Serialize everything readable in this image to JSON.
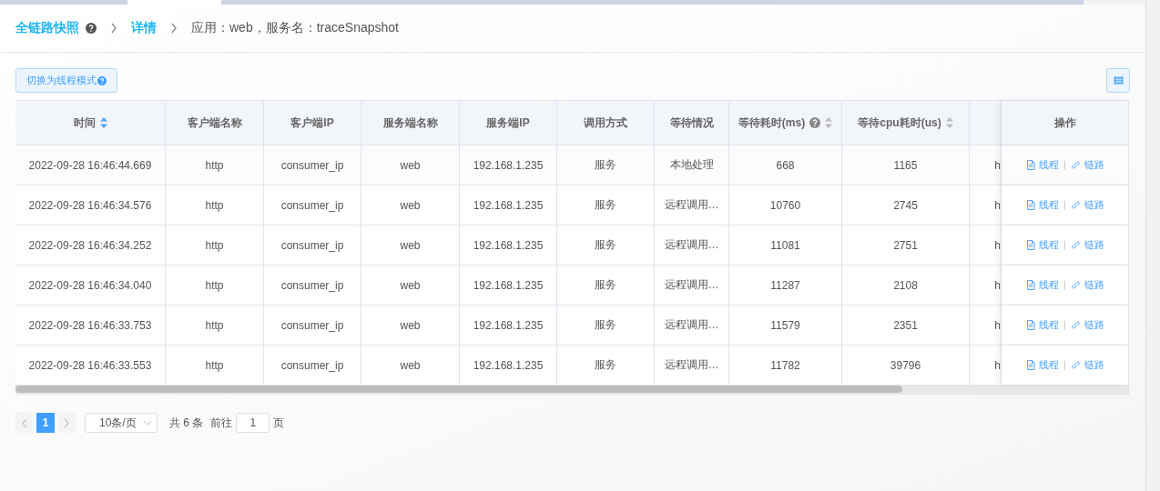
{
  "breadcrumb": [
    {
      "label": "全链路快照",
      "kind": "link",
      "help": true
    },
    {
      "label": "详情",
      "kind": "link",
      "help": false
    },
    {
      "label": "应用：web，服务名：traceSnapshot",
      "kind": "text",
      "help": false
    }
  ],
  "toolbar": {
    "mode_button": "切换为线程模式"
  },
  "table": {
    "columns": [
      {
        "label": "时间",
        "sortable": true,
        "sort_active": true,
        "help": false
      },
      {
        "label": "客户端名称",
        "sortable": false,
        "help": false
      },
      {
        "label": "客户端IP",
        "sortable": false,
        "help": false
      },
      {
        "label": "服务端名称",
        "sortable": false,
        "help": false
      },
      {
        "label": "服务端IP",
        "sortable": false,
        "help": false
      },
      {
        "label": "调用方式",
        "sortable": false,
        "help": false
      },
      {
        "label": "等待情况",
        "sortable": false,
        "help": false
      },
      {
        "label": "等待耗时(ms)",
        "sortable": true,
        "sort_active": false,
        "help": true
      },
      {
        "label": "等待cpu耗时(us)",
        "sortable": true,
        "sort_active": false,
        "help": false
      },
      {
        "sortable": false,
        "help": false
      },
      {
        "label": "操作",
        "sortable": false,
        "help": false
      }
    ],
    "rows": [
      {
        "cells": [
          "2022-09-28 16:46:44.669",
          "http",
          "consumer_ip",
          "web",
          "192.168.1.235",
          "服务",
          "本地处理",
          "668",
          "1165",
          "h"
        ],
        "actions": [
          "线程",
          "链路"
        ]
      },
      {
        "cells": [
          "2022-09-28 16:46:34.576",
          "http",
          "consumer_ip",
          "web",
          "192.168.1.235",
          "服务",
          "远程调用…",
          "10760",
          "2745",
          "h"
        ],
        "actions": [
          "线程",
          "链路"
        ]
      },
      {
        "cells": [
          "2022-09-28 16:46:34.252",
          "http",
          "consumer_ip",
          "web",
          "192.168.1.235",
          "服务",
          "远程调用…",
          "11081",
          "2751",
          "h"
        ],
        "actions": [
          "线程",
          "链路"
        ]
      },
      {
        "cells": [
          "2022-09-28 16:46:34.040",
          "http",
          "consumer_ip",
          "web",
          "192.168.1.235",
          "服务",
          "远程调用…",
          "11287",
          "2108",
          "h"
        ],
        "actions": [
          "线程",
          "链路"
        ]
      },
      {
        "cells": [
          "2022-09-28 16:46:33.753",
          "http",
          "consumer_ip",
          "web",
          "192.168.1.235",
          "服务",
          "远程调用…",
          "11579",
          "2351",
          "h"
        ],
        "actions": [
          "线程",
          "链路"
        ]
      },
      {
        "cells": [
          "2022-09-28 16:46:33.553",
          "http",
          "consumer_ip",
          "web",
          "192.168.1.235",
          "服务",
          "远程调用…",
          "11782",
          "39796",
          "h"
        ],
        "actions": [
          "线程",
          "链路"
        ]
      }
    ]
  },
  "pager": {
    "pages": [
      {
        "label": "1",
        "selected": true
      }
    ],
    "page_size": "10条/页",
    "total": "共 6 条",
    "goto_label": "前往",
    "goto_value": "1",
    "page_suffix": "页"
  }
}
